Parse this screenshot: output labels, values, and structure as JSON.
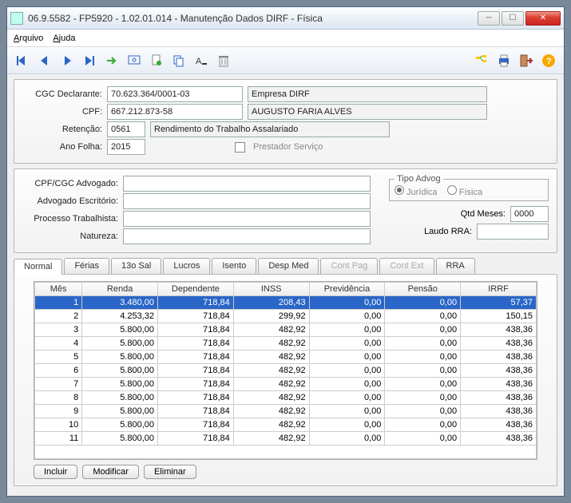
{
  "window": {
    "title": "06.9.5582 - FP5920 - 1.02.01.014 - Manutenção Dados DIRF - Física"
  },
  "menu": {
    "arquivo": "Arquivo",
    "ajuda": "Ajuda"
  },
  "form1": {
    "cgc_lbl": "CGC Declarante:",
    "cgc_val": "70.623.364/0001-03",
    "cgc_emp": "Empresa DIRF",
    "cpf_lbl": "CPF:",
    "cpf_val": "667.212.873-58",
    "cpf_nome": "AUGUSTO FARIA ALVES",
    "ret_lbl": "Retenção:",
    "ret_cod": "0561",
    "ret_desc": "Rendimento do Trabalho Assalariado",
    "ano_lbl": "Ano Folha:",
    "ano_val": "2015",
    "prest_lbl": "Prestador Serviço"
  },
  "form2": {
    "adv_cpf_lbl": "CPF/CGC Advogado:",
    "adv_esc_lbl": "Advogado Escritório:",
    "proc_lbl": "Processo Trabalhista:",
    "nat_lbl": "Natureza:",
    "tipo_leg": "Tipo Advog",
    "tipo_jur": "Jurídica",
    "tipo_fis": "Física",
    "qtd_lbl": "Qtd Meses:",
    "qtd_val": "0000",
    "laudo_lbl": "Laudo RRA:"
  },
  "tabs": {
    "normal": "Normal",
    "ferias": "Férias",
    "dec": "13o Sal",
    "lucros": "Lucros",
    "isento": "Isento",
    "desp": "Desp Med",
    "contp": "Cont Pag",
    "conte": "Cont Ext",
    "rra": "RRA"
  },
  "grid": {
    "headers": {
      "mes": "Mês",
      "renda": "Renda",
      "dep": "Dependente",
      "inss": "INSS",
      "prev": "Previdência",
      "pens": "Pensão",
      "irrf": "IRRF"
    },
    "rows": [
      {
        "m": "1",
        "r": "3.480,00",
        "d": "718,84",
        "i": "208,43",
        "p": "0,00",
        "pe": "0,00",
        "ir": "57,37"
      },
      {
        "m": "2",
        "r": "4.253,32",
        "d": "718,84",
        "i": "299,92",
        "p": "0,00",
        "pe": "0,00",
        "ir": "150,15"
      },
      {
        "m": "3",
        "r": "5.800,00",
        "d": "718,84",
        "i": "482,92",
        "p": "0,00",
        "pe": "0,00",
        "ir": "438,36"
      },
      {
        "m": "4",
        "r": "5.800,00",
        "d": "718,84",
        "i": "482,92",
        "p": "0,00",
        "pe": "0,00",
        "ir": "438,36"
      },
      {
        "m": "5",
        "r": "5.800,00",
        "d": "718,84",
        "i": "482,92",
        "p": "0,00",
        "pe": "0,00",
        "ir": "438,36"
      },
      {
        "m": "6",
        "r": "5.800,00",
        "d": "718,84",
        "i": "482,92",
        "p": "0,00",
        "pe": "0,00",
        "ir": "438,36"
      },
      {
        "m": "7",
        "r": "5.800,00",
        "d": "718,84",
        "i": "482,92",
        "p": "0,00",
        "pe": "0,00",
        "ir": "438,36"
      },
      {
        "m": "8",
        "r": "5.800,00",
        "d": "718,84",
        "i": "482,92",
        "p": "0,00",
        "pe": "0,00",
        "ir": "438,36"
      },
      {
        "m": "9",
        "r": "5.800,00",
        "d": "718,84",
        "i": "482,92",
        "p": "0,00",
        "pe": "0,00",
        "ir": "438,36"
      },
      {
        "m": "10",
        "r": "5.800,00",
        "d": "718,84",
        "i": "482,92",
        "p": "0,00",
        "pe": "0,00",
        "ir": "438,36"
      },
      {
        "m": "11",
        "r": "5.800,00",
        "d": "718,84",
        "i": "482,92",
        "p": "0,00",
        "pe": "0,00",
        "ir": "438,36"
      }
    ]
  },
  "btns": {
    "inc": "Incluir",
    "mod": "Modificar",
    "eli": "Eliminar"
  }
}
